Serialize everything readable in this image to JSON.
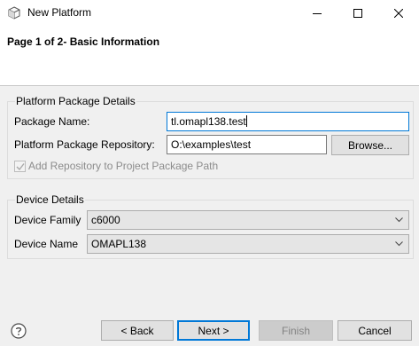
{
  "window": {
    "title": "New Platform"
  },
  "header": {
    "page_title": "Page 1 of 2- Basic Information"
  },
  "platform_group": {
    "title": "Platform Package Details",
    "package_name_label": "Package Name:",
    "package_name_value": "tl.omapl138.test",
    "repo_label": "Platform Package Repository:",
    "repo_value": "O:\\examples\\test",
    "browse_label": "Browse...",
    "add_repo_label": "Add Repository to Project Package Path",
    "add_repo_checked": true,
    "add_repo_enabled": false
  },
  "device_group": {
    "title": "Device Details",
    "family_label": "Device Family",
    "family_value": "c6000",
    "name_label": "Device Name",
    "name_value": "OMAPL138"
  },
  "footer": {
    "back_label": "< Back",
    "next_label": "Next >",
    "finish_label": "Finish",
    "cancel_label": "Cancel"
  },
  "icons": {
    "app": "cube-icon",
    "help": "help-icon",
    "minimize": "minimize-icon",
    "maximize": "maximize-icon",
    "close": "close-icon",
    "dropdown": "chevron-down-icon"
  },
  "colors": {
    "accent": "#0078d7",
    "dialog_bg": "#f0f0f0",
    "header_bg": "#ffffff"
  }
}
